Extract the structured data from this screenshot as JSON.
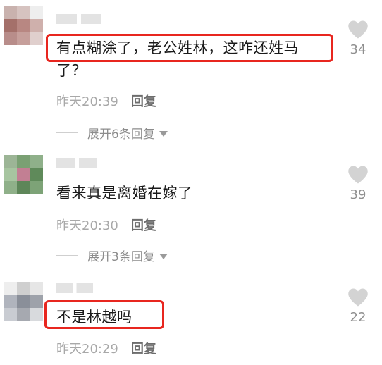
{
  "comments": [
    {
      "text_line1": "有点糊涂了，老公姓林，这咋还姓马",
      "text_line2": "了？",
      "time": "昨天20:39",
      "reply_label": "回复",
      "expand_label": "展开6条回复",
      "likes": "34"
    },
    {
      "text_line1": "看来真是离婚在嫁了",
      "time": "昨天20:30",
      "reply_label": "回复",
      "expand_label": "展开3条回复",
      "likes": "39"
    },
    {
      "text_line1": "不是林越吗",
      "time": "昨天20:29",
      "reply_label": "回复",
      "likes": "22"
    }
  ],
  "colors": {
    "highlight_border": "#e8261f",
    "reply_text": "#6d6d6d",
    "meta_text": "#a8a8a8"
  },
  "icons": {
    "like": "heart-icon",
    "expand": "triangle-down-icon"
  }
}
